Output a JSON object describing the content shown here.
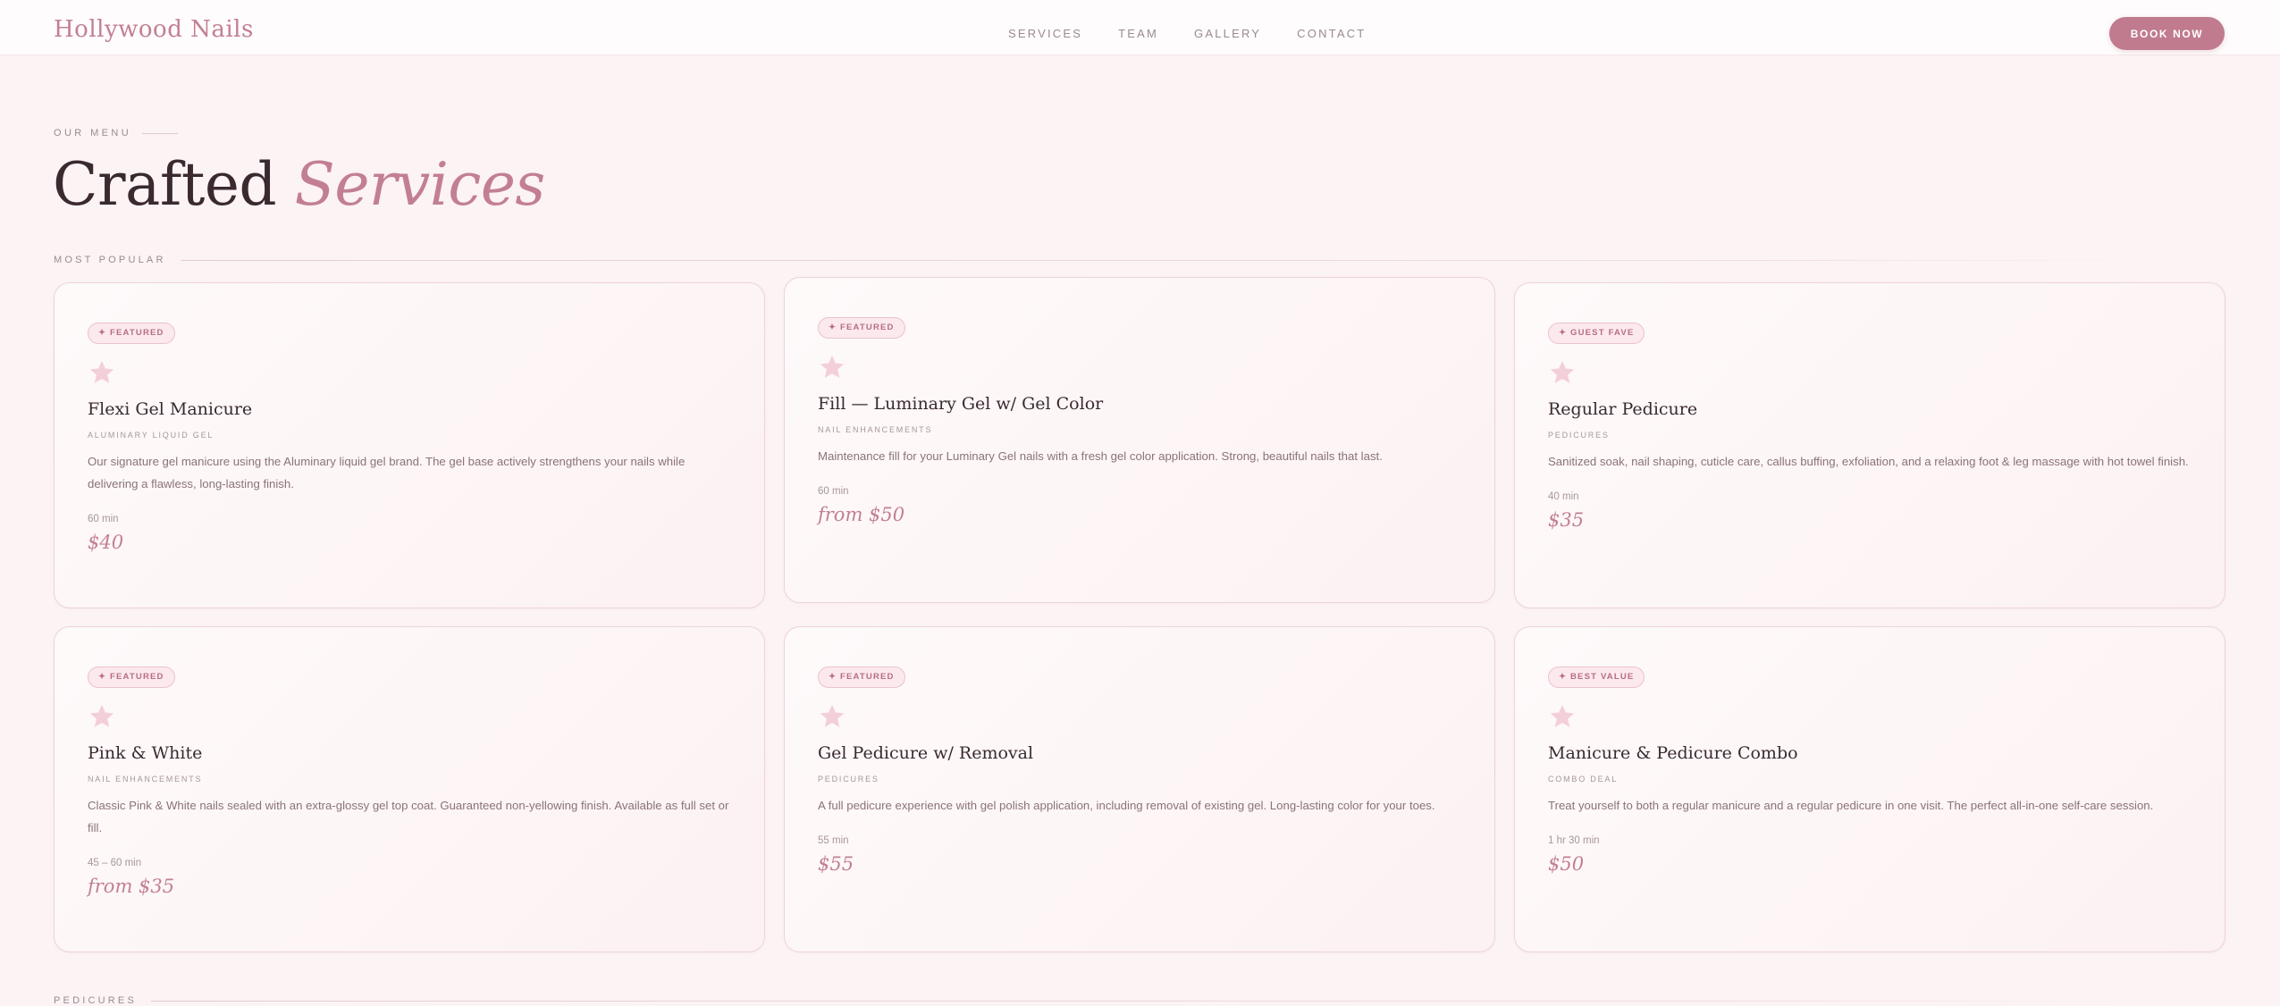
{
  "header": {
    "brand": "Hollywood Nails",
    "nav": [
      "SERVICES",
      "TEAM",
      "GALLERY",
      "CONTACT"
    ],
    "book_label": "BOOK NOW"
  },
  "section": {
    "eyebrow": "OUR MENU",
    "title_main": "Crafted",
    "title_accent": "Services"
  },
  "groups": {
    "popular": "MOST POPULAR",
    "pedicures": "PEDICURES"
  },
  "colors": {
    "accent": "#c27f93",
    "background": "#fcf3f4",
    "text": "#3a2a30"
  },
  "cards": [
    {
      "badge": "✦ FEATURED",
      "icon": "star-icon",
      "title": "Flexi Gel Manicure",
      "category": "ALUMINARY LIQUID GEL",
      "description": "Our signature gel manicure using the Aluminary liquid gel brand. The gel base actively strengthens your nails while delivering a flawless, long-lasting finish.",
      "duration": "60 min",
      "price": "$40"
    },
    {
      "badge": "✦ FEATURED",
      "icon": "star-icon",
      "title": "Fill — Luminary Gel w/ Gel Color",
      "category": "NAIL ENHANCEMENTS",
      "description": "Maintenance fill for your Luminary Gel nails with a fresh gel color application. Strong, beautiful nails that last.",
      "duration": "60 min",
      "price": "from $50"
    },
    {
      "badge": "✦ GUEST FAVE",
      "icon": "star-icon",
      "title": "Regular Pedicure",
      "category": "PEDICURES",
      "description": "Sanitized soak, nail shaping, cuticle care, callus buffing, exfoliation, and a relaxing foot & leg massage with hot towel finish.",
      "duration": "40 min",
      "price": "$35"
    },
    {
      "badge": "✦ FEATURED",
      "icon": "star-icon",
      "title": "Pink & White",
      "category": "NAIL ENHANCEMENTS",
      "description": "Classic Pink & White nails sealed with an extra-glossy gel top coat. Guaranteed non-yellowing finish. Available as full set or fill.",
      "duration": "45 – 60 min",
      "price": "from $35"
    },
    {
      "badge": "✦ FEATURED",
      "icon": "star-icon",
      "title": "Gel Pedicure w/ Removal",
      "category": "PEDICURES",
      "description": "A full pedicure experience with gel polish application, including removal of existing gel. Long-lasting color for your toes.",
      "duration": "55 min",
      "price": "$55"
    },
    {
      "badge": "✦ BEST VALUE",
      "icon": "star-icon",
      "title": "Manicure & Pedicure Combo",
      "category": "COMBO DEAL",
      "description": "Treat yourself to both a regular manicure and a regular pedicure in one visit. The perfect all-in-one self-care session.",
      "duration": "1 hr 30 min",
      "price": "$50"
    }
  ]
}
